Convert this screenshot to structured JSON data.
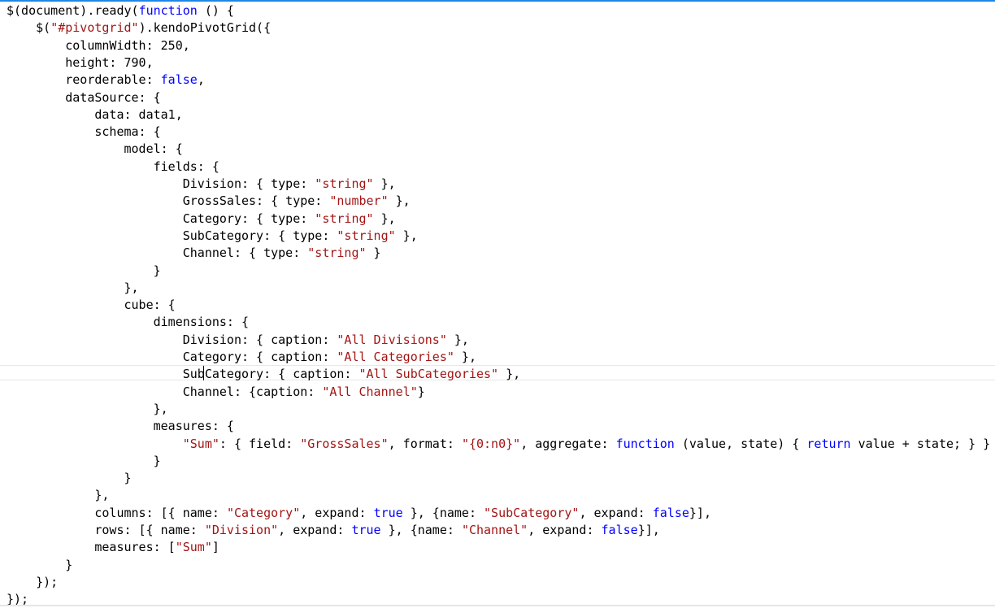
{
  "editor": {
    "colors": {
      "text": "#000000",
      "keyword": "#0000ff",
      "string": "#a31515",
      "accent": "#1e88e5"
    },
    "lines": [
      [
        {
          "t": "$(document).ready("
        },
        {
          "t": "function",
          "c": "kw"
        },
        {
          "t": " () {"
        }
      ],
      [
        {
          "t": "    $("
        },
        {
          "t": "\"#pivotgrid\"",
          "c": "str"
        },
        {
          "t": ").kendoPivotGrid({"
        }
      ],
      [
        {
          "t": "        columnWidth: 250,"
        }
      ],
      [
        {
          "t": "        height: 790,"
        }
      ],
      [
        {
          "t": "        reorderable: "
        },
        {
          "t": "false",
          "c": "kw"
        },
        {
          "t": ","
        }
      ],
      [
        {
          "t": "        dataSource: {"
        }
      ],
      [
        {
          "t": "            data: data1,"
        }
      ],
      [
        {
          "t": "            schema: {"
        }
      ],
      [
        {
          "t": "                model: {"
        }
      ],
      [
        {
          "t": "                    fields: {"
        }
      ],
      [
        {
          "t": "                        Division: { type: "
        },
        {
          "t": "\"string\"",
          "c": "str"
        },
        {
          "t": " },"
        }
      ],
      [
        {
          "t": "                        GrossSales: { type: "
        },
        {
          "t": "\"number\"",
          "c": "str"
        },
        {
          "t": " },"
        }
      ],
      [
        {
          "t": "                        Category: { type: "
        },
        {
          "t": "\"string\"",
          "c": "str"
        },
        {
          "t": " },"
        }
      ],
      [
        {
          "t": "                        SubCategory: { type: "
        },
        {
          "t": "\"string\"",
          "c": "str"
        },
        {
          "t": " },"
        }
      ],
      [
        {
          "t": "                        Channel: { type: "
        },
        {
          "t": "\"string\"",
          "c": "str"
        },
        {
          "t": " }"
        }
      ],
      [
        {
          "t": "                    }"
        }
      ],
      [
        {
          "t": "                },"
        }
      ],
      [
        {
          "t": "                cube: {"
        }
      ],
      [
        {
          "t": "                    dimensions: {"
        }
      ],
      [
        {
          "t": "                        Division: { caption: "
        },
        {
          "t": "\"All Divisions\"",
          "c": "str"
        },
        {
          "t": " },"
        }
      ],
      [
        {
          "t": "                        Category: { caption: "
        },
        {
          "t": "\"All Categories\"",
          "c": "str"
        },
        {
          "t": " },"
        }
      ],
      [
        {
          "t": "                        SubCategory: { caption: "
        },
        {
          "t": "\"All SubCategories\"",
          "c": "str"
        },
        {
          "t": " },"
        }
      ],
      [
        {
          "t": "                        Channel: {caption: "
        },
        {
          "t": "\"All Channel\"",
          "c": "str"
        },
        {
          "t": "}"
        }
      ],
      [
        {
          "t": "                    },"
        }
      ],
      [
        {
          "t": "                    measures: {"
        }
      ],
      [
        {
          "t": "                        "
        },
        {
          "t": "\"Sum\"",
          "c": "str"
        },
        {
          "t": ": { field: "
        },
        {
          "t": "\"GrossSales\"",
          "c": "str"
        },
        {
          "t": ", format: "
        },
        {
          "t": "\"{0:n0}\"",
          "c": "str"
        },
        {
          "t": ", aggregate: "
        },
        {
          "t": "function",
          "c": "kw"
        },
        {
          "t": " (value, state) { "
        },
        {
          "t": "return",
          "c": "kw"
        },
        {
          "t": " value + state; } }"
        }
      ],
      [
        {
          "t": "                    }"
        }
      ],
      [
        {
          "t": "                }"
        }
      ],
      [
        {
          "t": "            },"
        }
      ],
      [
        {
          "t": "            columns: [{ name: "
        },
        {
          "t": "\"Category\"",
          "c": "str"
        },
        {
          "t": ", expand: "
        },
        {
          "t": "true",
          "c": "kw"
        },
        {
          "t": " }, {name: "
        },
        {
          "t": "\"SubCategory\"",
          "c": "str"
        },
        {
          "t": ", expand: "
        },
        {
          "t": "false",
          "c": "kw"
        },
        {
          "t": "}],"
        }
      ],
      [
        {
          "t": "            rows: [{ name: "
        },
        {
          "t": "\"Division\"",
          "c": "str"
        },
        {
          "t": ", expand: "
        },
        {
          "t": "true",
          "c": "kw"
        },
        {
          "t": " }, {name: "
        },
        {
          "t": "\"Channel\"",
          "c": "str"
        },
        {
          "t": ", expand: "
        },
        {
          "t": "false",
          "c": "kw"
        },
        {
          "t": "}],"
        }
      ],
      [
        {
          "t": "            measures: ["
        },
        {
          "t": "\"Sum\"",
          "c": "str"
        },
        {
          "t": "]"
        }
      ],
      [
        {
          "t": "        }"
        }
      ],
      [
        {
          "t": "    });"
        }
      ],
      [
        {
          "t": "});"
        }
      ]
    ]
  }
}
